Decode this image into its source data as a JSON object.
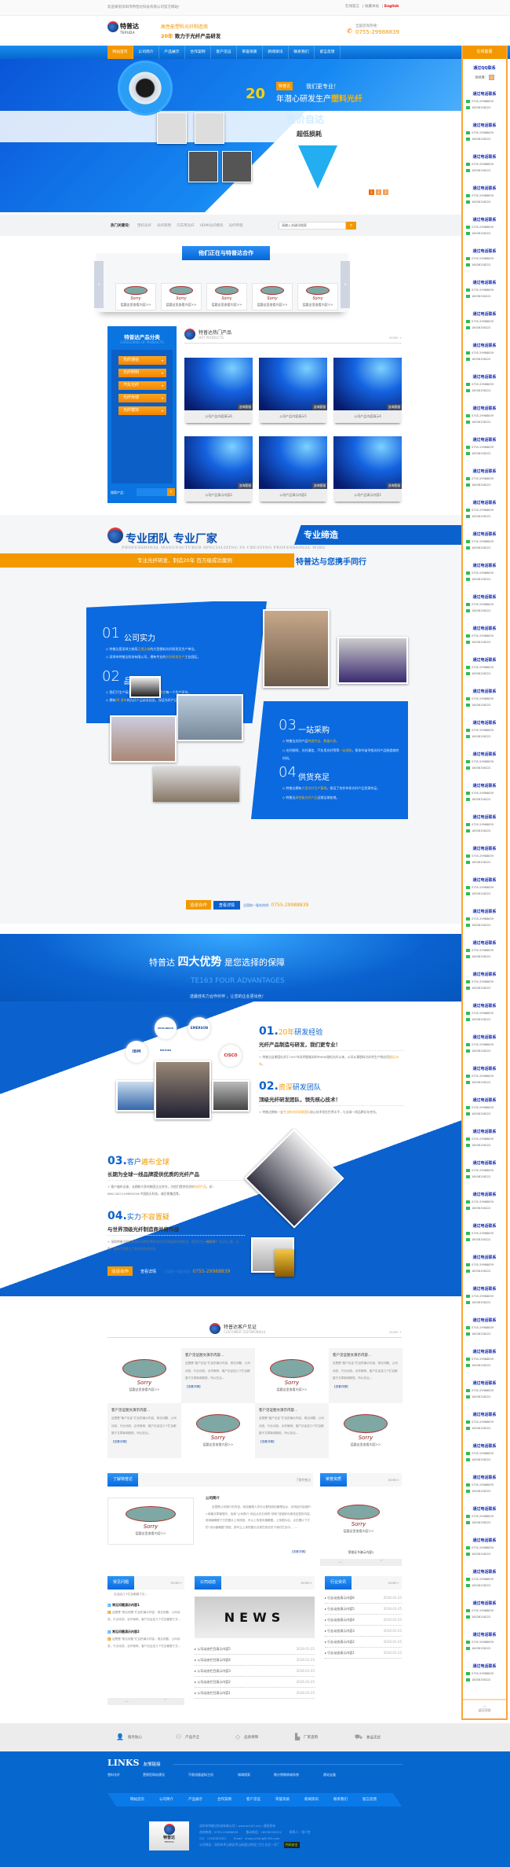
{
  "topbar": {
    "welcome": "欢迎来到深圳市特普达科技有限公司官方网站!",
    "links": [
      "在线留言",
      "收藏本站"
    ],
    "english": "English"
  },
  "header": {
    "logo_cn": "特普达",
    "logo_en": "TEPUDA",
    "slogan1": "高性能塑料光纤制造商",
    "slogan2_year": "20年",
    "slogan2_text": "致力于光纤产品研发",
    "hotline_label": "全国咨询热线：",
    "hotline": "0755-29988839"
  },
  "nav": {
    "items": [
      "网站首页",
      "公司简介",
      "产品展示",
      "合作案例",
      "客户见证",
      "荣誉资质",
      "新闻资讯",
      "联系我们",
      "留言反馈"
    ],
    "active": 0
  },
  "banner": {
    "badge": "特普达",
    "line1": "我们更专业！",
    "big": "20",
    "line2": "年潜心研发生产",
    "highlight": "塑料光纤",
    "faint1": "性价自达",
    "faint2": "超低损耗",
    "pages": [
      "1",
      "2",
      "3"
    ],
    "active_page": 0
  },
  "keywords": {
    "label": "热门关键词：",
    "items": [
      "塑料光纤",
      "光纤照明",
      "汽车用光纤",
      "HDMI光纤模块",
      "光纤传感"
    ],
    "search_placeholder": "请输入关键词搜索"
  },
  "partners": {
    "title": "他们正在与特普达合作",
    "card_caption": "Sorry",
    "card_link": "猛戳这里查看内容>>",
    "count": 5
  },
  "categories": {
    "title": "特普达产品分类",
    "subtitle": "CATEGORIES OF PRODUCTS",
    "items": [
      "光纤通信",
      "光纤照明",
      "汽车光纤",
      "光纤传感",
      "光纤模块"
    ],
    "search_label": "搜索产品："
  },
  "hot_products": {
    "title": "特普达热门产品",
    "subtitle": "HOT PRODUCTS",
    "more": "MORE +",
    "overlay": "咨询客服",
    "items": [
      "公司产品内容演示6",
      "公司产品内容演示5",
      "公司产品内容演示4",
      "公司产品演示内容3",
      "公司产品演示内容2",
      "公司产品演示内容1"
    ]
  },
  "team": {
    "title": "专业团队 专业厂家",
    "title_tag": "专业缔造",
    "english": "PROFESSIONAL MANUFACTURER SPECIALIZING IN CREATING PROFESSIONAL WIRE",
    "band": "专注光纤研发、制造20年    百万级成功案例",
    "band_right": "特普达与您携手同行",
    "blocks": [
      {
        "num": "01",
        "title": "公司实力",
        "lines": [
          [
            "特普达是深圳工商局",
            "正规注册",
            "的大型塑料光纤研发及生产单位。"
          ],
          [
            "深圳市特普达科技有限公司，拥有专业的",
            "光纤研发生产",
            "工业园区。"
          ]
        ]
      },
      {
        "num": "02",
        "title": "品质保障",
        "lines": [
          [
            "我们只生产高品质的塑料光纤，",
            "严格把控",
            "每一个生产环节。"
          ],
          [
            "拥有",
            "20 多年",
            "的光纤产品研发经验，保证光纤产品质量符合国际标准。"
          ]
        ]
      },
      {
        "num": "03",
        "title": "一站采购",
        "lines": [
          [
            "特普达光纤产品",
            "种类齐全、数量众多。",
            ""
          ],
          [
            "光纤照明、光纤通信、汽车用光纤等等",
            "一站采购",
            "，帮你节省寻找光纤产品制造商的时间。"
          ]
        ]
      },
      {
        "num": "04",
        "title": "供货充足",
        "lines": [
          [
            "特普达拥有",
            "大型光纤生产基地",
            "，保证了合作伙伴光纤产品货源充足。"
          ],
          [
            "特普达",
            "高性能光纤产品",
            "远销全球各地。"
          ]
        ]
      }
    ],
    "cta": {
      "talk": "洽谈合作",
      "detail": "查看详情",
      "hotline_label": "全国统一服务热线:",
      "hotline": "0755-29988839"
    }
  },
  "advantages": {
    "brand": "特普达",
    "big": "四大优势",
    "rest": "是您选择的保障",
    "english": "TE163 FOUR ADVANTAGES",
    "sub": "选最佳实力合作伙伴 ，让您的企业更出色！",
    "logos": [
      "MITSUBISHI MOTORS",
      "EMERSON",
      "IBM",
      "CISCO"
    ],
    "items": [
      {
        "num": "01.",
        "pre": "",
        "accent": "20年",
        "post": "研发经验",
        "subtitle": "光纤产品制造与研发，我们更专业！",
        "text": [
          "特普达自美国杜邦于1997年发明损耗料的PMMA塑料光纤以来，公司从事塑料光纤的生产和应用",
          "接近20年",
          "。"
        ]
      },
      {
        "num": "02.",
        "pre": "",
        "accent": "资深",
        "post": "研发团队",
        "subtitle": "顶级光纤研发团队，领先核心技术！",
        "text": [
          "特普达拥有一支",
          "专业的光纤研发团队",
          "核心技术领先世界水平，与全球一线品牌长年合作。"
        ]
      },
      {
        "num": "03.",
        "pre": "客户",
        "accent": "遍布全球",
        "post": "",
        "subtitle": "长期为全球一线品牌提供优质的光纤产品",
        "text": [
          "客户遍布全球，长期和众多的跨国企业合作，为他们提供优质的",
          "光纤产品",
          "，如：IBM,CISCO,EMERSON,中国航天科技，威尼斯集团等。"
        ]
      },
      {
        "num": "04.",
        "pre": "实力",
        "accent": "不容置疑",
        "post": "",
        "subtitle": "与世界顶级光纤制造商并肩作战",
        "text": [
          "深圳特普达科技有限公司和世界知名的光纤制造商并肩作战，受到行业",
          "一致好评！",
          "与日本三菱、东丽、旭硝子等建立了良好的合作关系。"
        ]
      }
    ],
    "cta": {
      "talk": "洽谈合作",
      "detail": "查看详情",
      "hotline_label": "全国统一服务热线:",
      "hotline": "0755-29988839"
    }
  },
  "testimonials": {
    "title": "特普达客户见证",
    "subtitle": "CUSTOMER TESTIMONIALS",
    "more": "MORE +",
    "image_caption": "Sorry",
    "image_link": "猛戳这里查看内容>>",
    "items": [
      {
        "title": "客户见证图文演示内容...",
        "text": "这是是“客户见证”栏目的演示内容，常见问题、公司动态、行业动态、合作案例、客户见证这几个栏目都属于文章新闻类型，所以在后...",
        "link": "【查看详情】"
      },
      {
        "title": "客户见证图文演示内容...",
        "text": "这是是“客户见证”栏目的演示内容，常见问题、公司动态、行业动态、合作案例、客户见证这几个栏目都属于文章新闻类型，所以在后...",
        "link": "【查看详情】"
      },
      {
        "title": "客户见证图文演示内容...",
        "text": "这是是“客户见证”栏目的演示内容，常见问题、公司动态、行业动态、合作案例、客户见证这几个栏目都属于文章新闻类型，所以在后...",
        "link": "【查看详情】"
      },
      {
        "title": "客户见证图文演示内容...",
        "text": "这是是“客户见证”栏目的演示内容，常见问题、公司动态、行业动态、合作案例、客户见证这几个栏目都属于文章新闻类型，所以在后...",
        "link": "【查看详情】"
      }
    ]
  },
  "about": {
    "tab": "了解特普达",
    "right_link": "了解特普达",
    "heading": "公司简介",
    "text": "这里是公司简介的内容，网站管理人员可以登陆网站管理后台，在网站内容维护->单篇文章管理中，找到“公司简介”然后点击右侧的“修改”按钮即可修改这里的内容，使用编辑框下方的图片上传按钮，可以上传首页缩略图。上传图片后，点击图片下方的“设为缩略图”按钮，即可让上传的图片出现在首页关于我们栏目中。......",
    "more": "【查看详情】",
    "image_caption": "Sorry",
    "image_link": "猛戳这里查看内容>>"
  },
  "honors": {
    "tab": "荣誉资质",
    "more": "MORE+",
    "caption": "荣誉证书演示内容2",
    "image_caption": "Sorry",
    "image_link": "猛戳这里查看内容>>"
  },
  "faq": {
    "tab": "常见问题",
    "more": "MORE+",
    "top_fragment": "见证这几个栏目都属于文...",
    "items": [
      {
        "q": "常见问题演示内容1",
        "a": "这是是“常见问题”栏目的演示内容，常见问题、公司动态、行业动态、合作案例、客户见证这几个栏目都属于文..."
      },
      {
        "q": "常见问题演示内容2",
        "a": "这是是“常见问题”栏目的演示内容，常见问题、公司动态、行业动态、合作案例、客户见证这几个栏目都属于文..."
      }
    ]
  },
  "news": {
    "tab": "公司动态",
    "more": "MORE+",
    "image_text": "NEWS",
    "items": [
      {
        "title": "公司动态栏目演示内容5",
        "date": "2016-01-25"
      },
      {
        "title": "公司动态栏目演示内容4",
        "date": "2016-01-25"
      },
      {
        "title": "公司动态栏目演示内容3",
        "date": "2016-01-25"
      },
      {
        "title": "公司动态栏目演示内容2",
        "date": "2016-01-25"
      },
      {
        "title": "公司动态栏目演示内容1",
        "date": "2016-01-25"
      }
    ]
  },
  "industry": {
    "tab": "行业资讯",
    "more": "MORE+",
    "items": [
      {
        "title": "行业动态演示内容6",
        "date": "2016-01-25"
      },
      {
        "title": "行业动态演示内容5",
        "date": "2016-01-25"
      },
      {
        "title": "行业动态演示内容4",
        "date": "2016-01-25"
      },
      {
        "title": "行业动态演示内容3",
        "date": "2016-01-25"
      },
      {
        "title": "行业动态演示内容2",
        "date": "2016-01-25"
      },
      {
        "title": "行业动态演示内容1",
        "date": "2016-01-25"
      }
    ]
  },
  "features": [
    {
      "icon": "user-heart-icon",
      "label": "服务贴心"
    },
    {
      "icon": "network-icon",
      "label": "产品齐全"
    },
    {
      "icon": "diamond-icon",
      "label": "品质保障"
    },
    {
      "icon": "factory-icon",
      "label": "厂家直销"
    },
    {
      "icon": "truck-icon",
      "label": "售后无忧"
    }
  ],
  "footer": {
    "links_title": "LINKS",
    "links_sub": "友情链接",
    "links": [
      "塑料光纤",
      "营销型网站建设",
      "不限流量虚拟主机",
      "城域搜索",
      "微分销微商城系统",
      "建站宝盒"
    ],
    "nav": [
      "网站首页",
      "公司简介",
      "产品展示",
      "合作案例",
      "客户见证",
      "荣誉资质",
      "新闻资讯",
      "联系我们",
      "留言反馈"
    ],
    "logo_cn": "特普达",
    "logo_en": "TEPUDA",
    "copyright": "深圳市特普达科技有限公司 ( www.te163.net ) 版权所有",
    "hotline": "咨询热线：0755-29988839",
    "mobile": "移动电话：18038158222",
    "contact": "联系人：张少宜",
    "qq": "QQ：1320083183",
    "email": "Email：shaoyizhang@163.com",
    "address": "公司地址：深圳市坪山新区坪山街道江岭园三河工业区一号厂",
    "safe_badge": "代码安全"
  },
  "sidebar": {
    "title": "在线客服",
    "qq_label": "通过QQ联系",
    "manager": "张经理：",
    "phone_group_label": "通过电话联系",
    "tel": "0755-29988839",
    "mobile": "18038158222",
    "group_count": 51,
    "back_to_top": "返回顶部"
  },
  "colors": {
    "brand_blue": "#0b62cf",
    "accent_orange": "#f39800"
  }
}
